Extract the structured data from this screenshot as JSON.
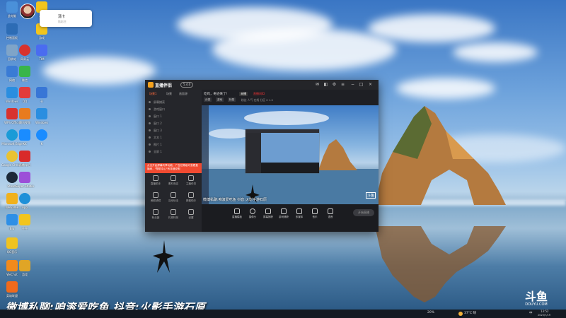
{
  "notification": {
    "title": "蒲卡",
    "subtitle": "炫彩主"
  },
  "desktop_icons": [
    {
      "label": "此电脑",
      "color": "#4a90d9",
      "icon": "computer-icon"
    },
    {
      "label": "控制面板",
      "color": "#2d6cb5",
      "icon": "control-panel-icon"
    },
    {
      "label": "回收站",
      "color": "#7fa4c8",
      "icon": "recycle-bin-icon"
    },
    {
      "label": "网络",
      "color": "#3a7bd5",
      "icon": "network-icon"
    },
    {
      "label": "Windows",
      "color": "#2a8ee0",
      "icon": "windows-icon"
    },
    {
      "label": "WPS Office",
      "color": "#d8322e",
      "icon": "wps-icon"
    },
    {
      "label": "Microsoft Edge",
      "color": "#1a9bd7",
      "icon": "edge-icon"
    },
    {
      "label": "Google Chrome",
      "color": "#e9c232",
      "icon": "chrome-icon"
    },
    {
      "label": "Steam",
      "color": "#1b2838",
      "icon": "steam-icon"
    },
    {
      "label": "WeGame",
      "color": "#f0b11d",
      "icon": "wegame-icon"
    },
    {
      "label": "Biu",
      "color": "#2e8fe6",
      "icon": "app-icon"
    },
    {
      "label": "QQ音乐",
      "color": "#f0c320",
      "icon": "music-icon"
    },
    {
      "label": "WeChat",
      "color": "#f28a1c",
      "icon": "wechat-icon"
    },
    {
      "label": "英雄联盟",
      "color": "#f06a1c",
      "icon": "game-icon"
    }
  ],
  "desktop_icons_col2": [
    {
      "label": "网易云",
      "color": "#d8322e",
      "icon": "netease-icon"
    },
    {
      "label": "微信",
      "color": "#39b54a",
      "icon": "wechat-icon"
    },
    {
      "label": "QQ",
      "color": "#e23b3b",
      "icon": "qq-icon"
    },
    {
      "label": "腾讯视频",
      "color": "#e87b1e",
      "icon": "video-icon"
    },
    {
      "label": "KK",
      "color": "#1a8cff",
      "icon": "app-icon"
    },
    {
      "label": "直播伴侣",
      "color": "#d92a2a",
      "icon": "live-icon"
    },
    {
      "label": "Super Studio",
      "color": "#9c4fd8",
      "icon": "studio-icon"
    },
    {
      "label": "App",
      "color": "#1e90d8",
      "icon": "app-icon"
    },
    {
      "label": "千牛",
      "color": "#f2c51d",
      "icon": "app-icon"
    },
    {
      "label": "游戏",
      "color": "#e0a526",
      "icon": "game-icon"
    }
  ],
  "desktop_icons_col3": [
    {
      "label": "斗鱼",
      "color": "#f2c51d",
      "icon": "douyu-icon"
    },
    {
      "label": "游戏",
      "color": "#f2c51d",
      "icon": "game-icon"
    },
    {
      "label": "TIM",
      "color": "#4a6cf0",
      "icon": "tim-icon"
    },
    {
      "label": "卡",
      "color": "#3876d6",
      "icon": "card-icon"
    },
    {
      "label": "Windows",
      "color": "#2a8ee0",
      "icon": "windows-icon"
    },
    {
      "label": "K",
      "color": "#1a8cff",
      "icon": "k-icon"
    }
  ],
  "app": {
    "name": "直播伴侣",
    "version": "5.4.0",
    "left_tabs": [
      "场景1",
      "场景",
      "画面源"
    ],
    "left_rows": [
      "屏幕捕获",
      "游戏窗口",
      "窗口 1",
      "窗口 2",
      "窗口 3",
      "文本 1",
      "图片 1",
      "全屏 1"
    ],
    "banner": "点击开启屏幕共享功能，广告位等级可查看直播间，\"帮助中心\"有详细说明",
    "tools": [
      [
        "直播助手",
        "素材商店",
        "主播任务"
      ],
      [
        "美颜滤镜",
        "互动玩法",
        "弹幕助手"
      ],
      [
        "粉丝团",
        "礼物特效",
        "设置"
      ]
    ],
    "room_title": "吃鸡，奇迹来了!",
    "room_status": "未播",
    "room_live": "直播间ID",
    "room_meta": "粉丝 人气 在线 分区 0 1.0",
    "chips": [
      "分类",
      "游戏",
      "标签"
    ],
    "preview_caption": "微博私聊:咱滚爱吃鱼 抖音:火影手游石原",
    "preview_badge": "斗鱼",
    "bottom_items": [
      "直播模板",
      "摄像头",
      "屏幕捕获",
      "游戏捕获",
      "多媒体",
      "音乐",
      "语音"
    ],
    "start_live": "开始直播"
  },
  "bottom_caption": "微博私聊:咱滚爱吃鱼 抖音:火影手游石原",
  "douyu": {
    "mark": "斗鱼",
    "sub": "DOUYU.COM"
  },
  "taskbar": {
    "weather": "37°C 晴",
    "time": "13:52",
    "date": "2023/7/19",
    "lang": "中",
    "pct": "20%"
  }
}
